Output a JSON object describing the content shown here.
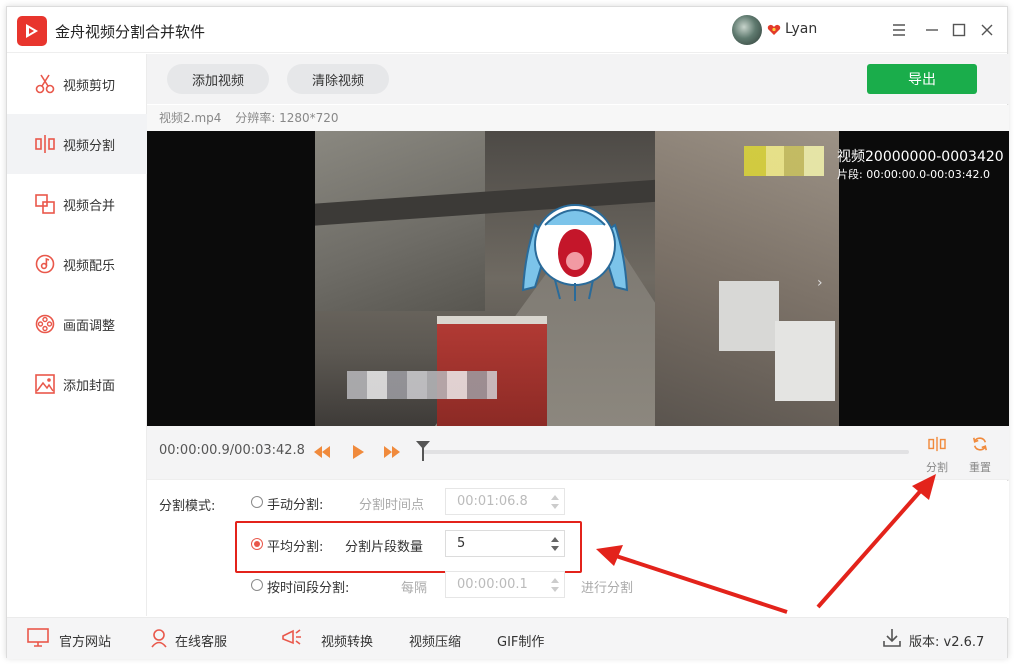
{
  "app": {
    "title": "金舟视频分割合并软件",
    "user_name": "Lyan"
  },
  "sidebar": {
    "items": [
      {
        "label": "视频剪切",
        "icon": "scissors-icon",
        "active": false
      },
      {
        "label": "视频分割",
        "icon": "split-icon",
        "active": true
      },
      {
        "label": "视频合并",
        "icon": "merge-icon",
        "active": false
      },
      {
        "label": "视频配乐",
        "icon": "music-icon",
        "active": false
      },
      {
        "label": "画面调整",
        "icon": "film-reel-icon",
        "active": false
      },
      {
        "label": "添加封面",
        "icon": "image-icon",
        "active": false
      }
    ]
  },
  "toolbar": {
    "add_label": "添加视频",
    "clear_label": "清除视频",
    "export_label": "导出"
  },
  "file": {
    "name": "视频2.mp4",
    "resolution": "分辨率: 1280*720"
  },
  "video": {
    "clip_name": "视频20000000-0003420",
    "segment": "片段:  00:00:00.0-00:03:42.0"
  },
  "timeline": {
    "timecode": "00:00:00.9/00:03:42.8",
    "split_label": "分割",
    "reset_label": "重置"
  },
  "settings": {
    "mode_label": "分割模式:",
    "manual": {
      "label": "手动分割:",
      "field_label": "分割时间点",
      "value": "00:01:06.8"
    },
    "average": {
      "label": "平均分割:",
      "field_label": "分割片段数量",
      "value": "5"
    },
    "by_time": {
      "label": "按时间段分割:",
      "field_label": "每隔",
      "value": "00:00:00.1",
      "suffix": "进行分割"
    },
    "selected_mode": "average"
  },
  "footer": {
    "website": "官方网站",
    "support": "在线客服",
    "convert": "视频转换",
    "compress": "视频压缩",
    "gif": "GIF制作",
    "version": "版本: v2.6.7"
  },
  "colors": {
    "accent_green": "#1aad4b",
    "accent_red": "#e3231b",
    "accent_orange": "#e9584b"
  }
}
